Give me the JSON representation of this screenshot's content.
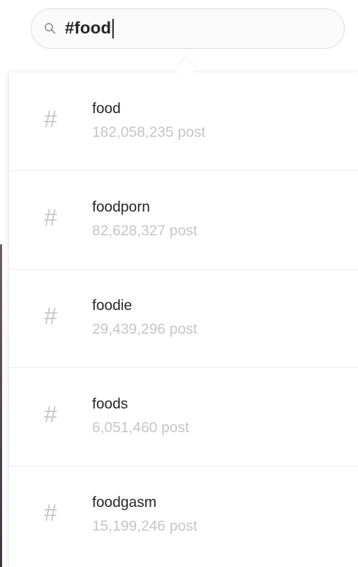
{
  "search": {
    "value": "#food",
    "icon": "search-icon"
  },
  "results": [
    {
      "icon": "hashtag-icon",
      "hash": "#",
      "tag": "food",
      "count": "182,058,235 post"
    },
    {
      "icon": "hashtag-icon",
      "hash": "#",
      "tag": "foodporn",
      "count": "82,628,327 post"
    },
    {
      "icon": "hashtag-icon",
      "hash": "#",
      "tag": "foodie",
      "count": "29,439,296 post"
    },
    {
      "icon": "hashtag-icon",
      "hash": "#",
      "tag": "foods",
      "count": "6,051,460 post"
    },
    {
      "icon": "hashtag-icon",
      "hash": "#",
      "tag": "foodgasm",
      "count": "15,199,246 post"
    }
  ],
  "colors": {
    "primary_text": "#262626",
    "secondary_text": "#c6c6c6",
    "hash_icon": "#c7c7c7",
    "divider": "#ededed"
  }
}
